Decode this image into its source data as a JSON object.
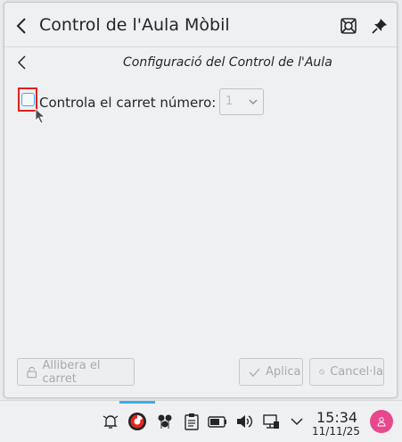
{
  "window": {
    "title": "Control de l'Aula Mòbil",
    "icons": [
      "back-icon",
      "lifebuoy-icon",
      "pin-icon"
    ]
  },
  "page": {
    "subtitle": "Configuració del Control de l'Aula"
  },
  "form": {
    "checkbox_label": "Controla el carret número:",
    "checkbox_checked": false,
    "combo_value": "1"
  },
  "buttons": {
    "release": "Allibera el carret",
    "apply": "Aplica",
    "cancel": "Cancel·la"
  },
  "taskbar": {
    "time": "15:34",
    "date": "11/11/25",
    "tray_icons": [
      "notifications-icon",
      "app-icon",
      "network-icon",
      "clipboard-icon",
      "battery-icon",
      "volume-icon",
      "display-icon",
      "expand-icon"
    ]
  },
  "colors": {
    "accent": "#3daee9",
    "highlight": "#e02020",
    "avatar": "#e8478d"
  }
}
